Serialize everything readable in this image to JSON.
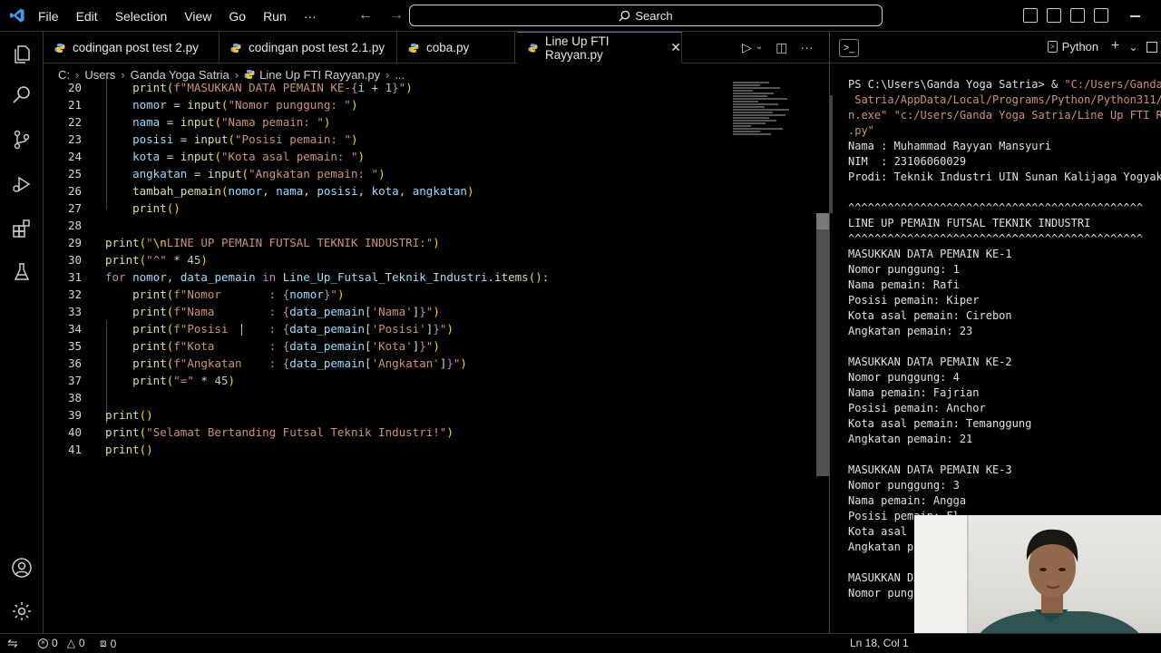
{
  "menu": [
    "File",
    "Edit",
    "Selection",
    "View",
    "Go",
    "Run",
    "···"
  ],
  "search": {
    "label": "Search"
  },
  "tabs": [
    {
      "label": "codingan post test 2.py"
    },
    {
      "label": "codingan post test 2.1.py"
    },
    {
      "label": "coba.py"
    },
    {
      "label": "Line Up FTI Rayyan.py",
      "active": true
    }
  ],
  "breadcrumb": [
    "C:",
    "Users",
    "Ganda Yoga Satria",
    "Line Up FTI Rayyan.py",
    "..."
  ],
  "code": {
    "line_numbers": [
      "20",
      "21",
      "22",
      "23",
      "24",
      "25",
      "26",
      "27",
      "28",
      "29",
      "30",
      "31",
      "32",
      "33",
      "34",
      "35",
      "36",
      "37",
      "38",
      "39",
      "40",
      "41"
    ]
  },
  "panel": {
    "shell": "Python",
    "terminal_lines": [
      "PS C:\\Users\\Ganda Yoga Satria> & \"C:/Users/Ganda Yoga",
      " Satria/AppData/Local/Programs/Python/Python311/py",
      "n.exe\" \"c:/Users/Ganda Yoga Satria/Line Up FTI Ray",
      ".py\"",
      "Nama : Muhammad Rayyan Mansyuri",
      "NIM  : 23106060029",
      "Prodi: Teknik Industri UIN Sunan Kalijaga Yogyakar",
      "",
      "^^^^^^^^^^^^^^^^^^^^^^^^^^^^^^^^^^^^^^^^^^^^^",
      "LINE UP PEMAIN FUTSAL TEKNIK INDUSTRI",
      "^^^^^^^^^^^^^^^^^^^^^^^^^^^^^^^^^^^^^^^^^^^^^",
      "MASUKKAN DATA PEMAIN KE-1",
      "Nomor punggung: 1",
      "Nama pemain: Rafi",
      "Posisi pemain: Kiper",
      "Kota asal pemain: Cirebon",
      "Angkatan pemain: 23",
      "",
      "MASUKKAN DATA PEMAIN KE-2",
      "Nomor punggung: 4",
      "Nama pemain: Fajrian",
      "Posisi pemain: Anchor",
      "Kota asal pemain: Temanggung",
      "Angkatan pemain: 21",
      "",
      "MASUKKAN DATA PEMAIN KE-3",
      "Nomor punggung: 3",
      "Nama pemain: Angga",
      "Posisi pemain: Fl",
      "Kota asal p",
      "Angkatan pe",
      "",
      "MASUKKAN DA",
      "Nomor pungg"
    ]
  },
  "status": {
    "errors": "0",
    "warnings": "0",
    "ports": "0",
    "position": "Ln 18, Col 1"
  },
  "colors": {
    "keyword": "#c586c0",
    "function": "#dcdcaa",
    "variable": "#9cdcfe",
    "string": "#ce9178",
    "number": "#b5cea8"
  }
}
